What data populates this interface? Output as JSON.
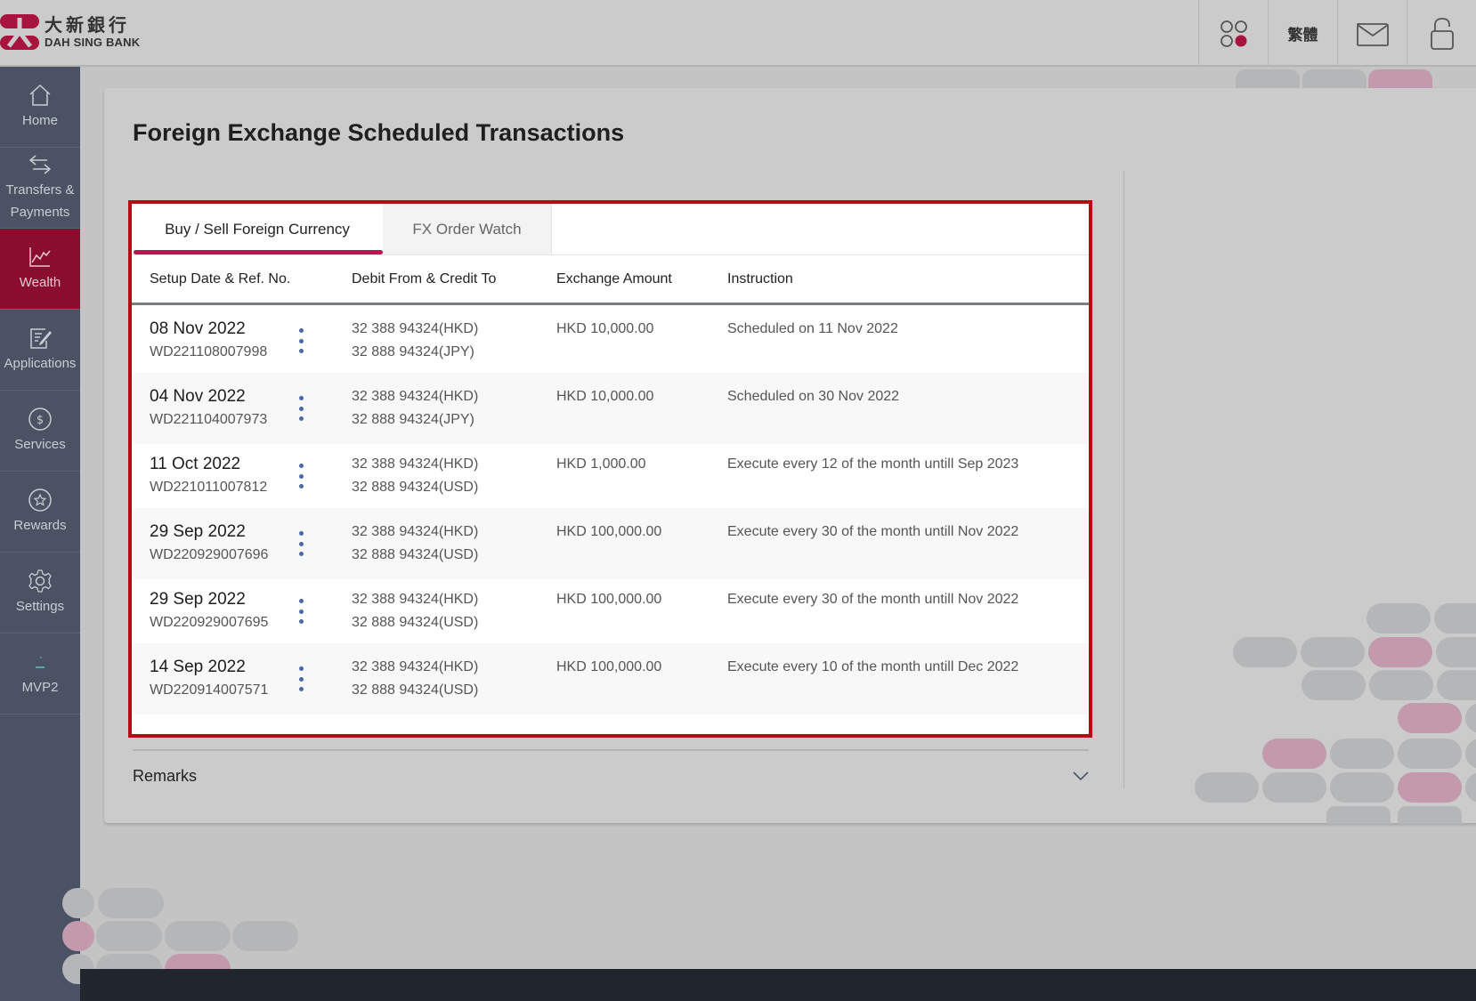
{
  "brand": {
    "name_cn": "大新銀行",
    "name_en": "DAH SING BANK",
    "accent_color": "#a9133f"
  },
  "header": {
    "actions": [
      {
        "name": "apps",
        "icon": "apps-grid-icon"
      },
      {
        "name": "language",
        "label": "繁體"
      },
      {
        "name": "messages",
        "icon": "mail-icon"
      },
      {
        "name": "logout",
        "icon": "unlock-icon"
      }
    ]
  },
  "sidebar": {
    "items": [
      {
        "label": "Home",
        "icon": "home-icon",
        "active": false
      },
      {
        "label": "Transfers & Payments",
        "line1": "Transfers &",
        "line2": "Payments",
        "icon": "transfer-arrows-icon",
        "active": false
      },
      {
        "label": "Wealth",
        "icon": "chart-line-icon",
        "active": true
      },
      {
        "label": "Applications",
        "icon": "edit-document-icon",
        "active": false
      },
      {
        "label": "Services",
        "icon": "dollar-circle-icon",
        "active": false
      },
      {
        "label": "Rewards",
        "icon": "star-circle-icon",
        "active": false
      },
      {
        "label": "Settings",
        "icon": "gear-icon",
        "active": false
      },
      {
        "label": "MVP2",
        "icon": "mvp-icon",
        "active": false
      }
    ]
  },
  "page": {
    "title": "Foreign Exchange Scheduled Transactions",
    "tabs": [
      {
        "label": "Buy / Sell Foreign Currency",
        "active": true
      },
      {
        "label": "FX Order Watch",
        "active": false
      }
    ],
    "table": {
      "columns": [
        "Setup Date & Ref. No.",
        "Debit From & Credit To",
        "Exchange Amount",
        "Instruction"
      ],
      "rows": [
        {
          "date": "08 Nov 2022",
          "ref": "WD221108007998",
          "debit": "32 388 94324(HKD)",
          "credit": "32 888 94324(JPY)",
          "amount": "HKD 10,000.00",
          "instruction": "Scheduled on 11 Nov 2022"
        },
        {
          "date": "04 Nov 2022",
          "ref": "WD221104007973",
          "debit": "32 388 94324(HKD)",
          "credit": "32 888 94324(JPY)",
          "amount": "HKD 10,000.00",
          "instruction": "Scheduled on 30 Nov 2022"
        },
        {
          "date": "11 Oct 2022",
          "ref": "WD221011007812",
          "debit": "32 388 94324(HKD)",
          "credit": "32 888 94324(USD)",
          "amount": "HKD 1,000.00",
          "instruction": "Execute every 12 of the month untill Sep 2023"
        },
        {
          "date": "29 Sep 2022",
          "ref": "WD220929007696",
          "debit": "32 388 94324(HKD)",
          "credit": "32 888 94324(USD)",
          "amount": "HKD 100,000.00",
          "instruction": "Execute every 30 of the month untill Nov 2022"
        },
        {
          "date": "29 Sep 2022",
          "ref": "WD220929007695",
          "debit": "32 388 94324(HKD)",
          "credit": "32 888 94324(USD)",
          "amount": "HKD 100,000.00",
          "instruction": "Execute every 30 of the month untill Nov 2022"
        },
        {
          "date": "14 Sep 2022",
          "ref": "WD220914007571",
          "debit": "32 388 94324(HKD)",
          "credit": "32 888 94324(USD)",
          "amount": "HKD 100,000.00",
          "instruction": "Execute every 10 of the month untill Dec 2022"
        }
      ]
    },
    "remarks": {
      "label": "Remarks",
      "expanded": false
    }
  }
}
